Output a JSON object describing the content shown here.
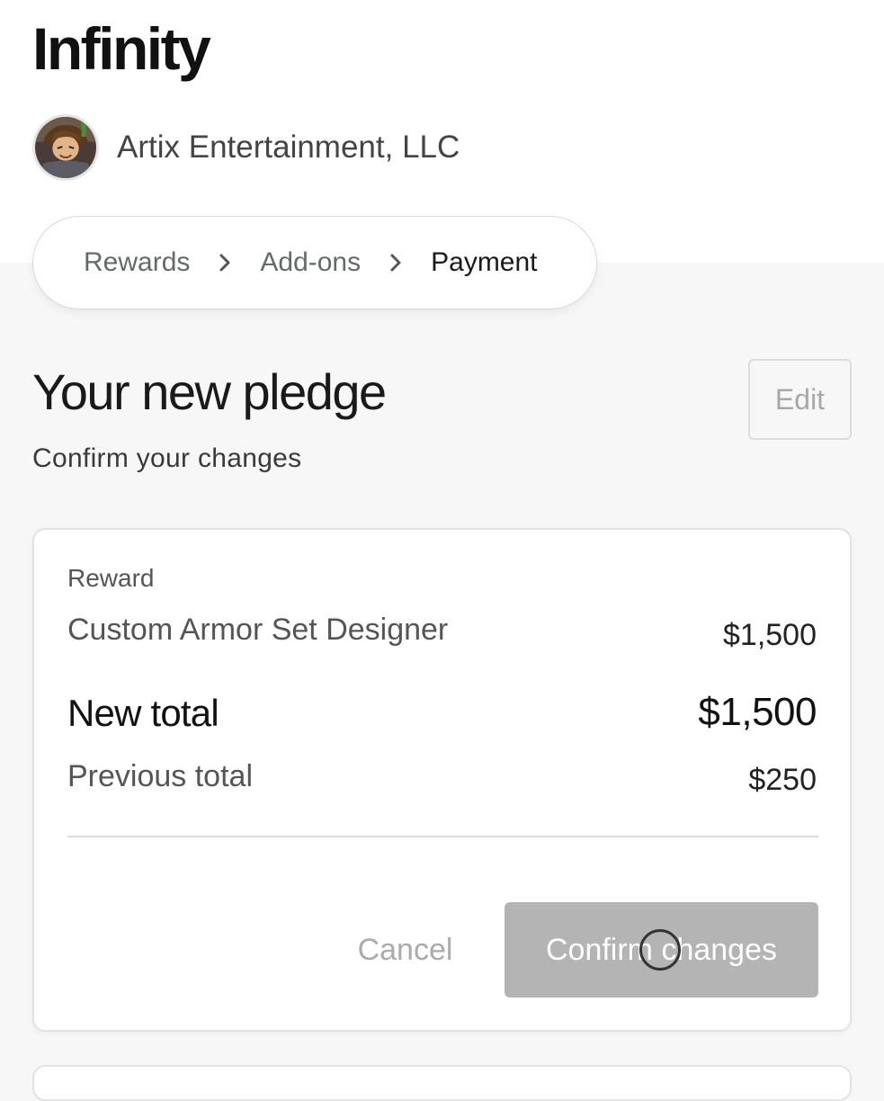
{
  "project": {
    "title": "Infinity",
    "creator_name": "Artix Entertainment, LLC",
    "avatar_icon": "creator-avatar"
  },
  "breadcrumb": {
    "items": [
      {
        "label": "Rewards",
        "current": false
      },
      {
        "label": "Add-ons",
        "current": false
      },
      {
        "label": "Payment",
        "current": true
      }
    ],
    "separator_icon": "chevron-right-icon"
  },
  "pledge": {
    "title": "Your new pledge",
    "subtitle": "Confirm your changes",
    "edit_label": "Edit"
  },
  "summary": {
    "reward_label": "Reward",
    "reward_name": "Custom Armor Set Designer",
    "reward_price": "$1,500",
    "new_total_label": "New total",
    "new_total_value": "$1,500",
    "previous_total_label": "Previous total",
    "previous_total_value": "$250",
    "cancel_label": "Cancel",
    "confirm_label": "Confirm changes"
  },
  "colors": {
    "confirm_button_disabled": "#b4b4b4",
    "background": "#f7f7f7"
  }
}
